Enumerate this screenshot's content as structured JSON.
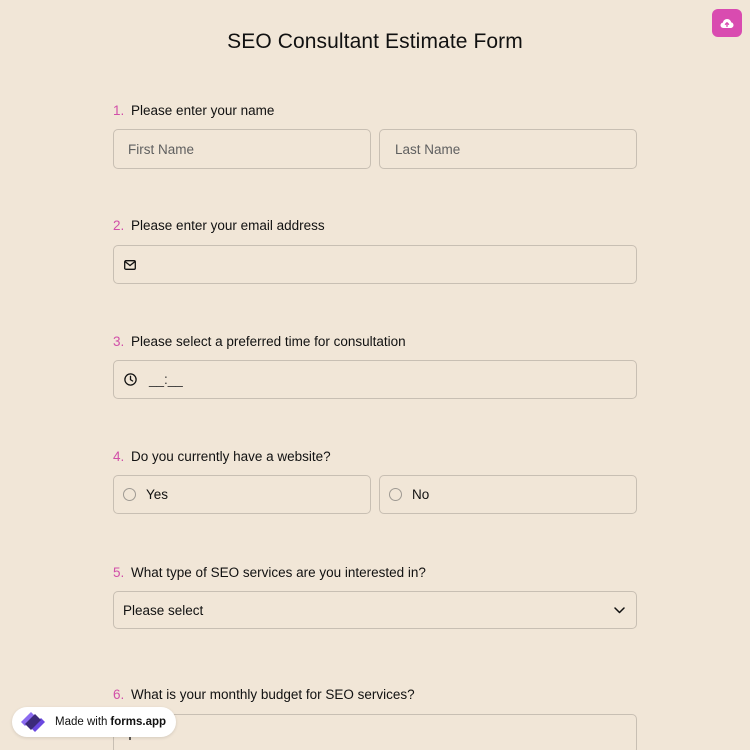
{
  "header": {
    "title": "SEO Consultant Estimate Form",
    "upload_icon": "cloud-upload-icon"
  },
  "questions": [
    {
      "number": "1.",
      "label": "Please enter your name",
      "fields": [
        {
          "placeholder": "First Name"
        },
        {
          "placeholder": "Last Name"
        }
      ]
    },
    {
      "number": "2.",
      "label": "Please enter your email address",
      "icon": "mail-icon",
      "value": ""
    },
    {
      "number": "3.",
      "label": "Please select a preferred time for consultation",
      "icon": "clock-icon",
      "mask": "__:__"
    },
    {
      "number": "4.",
      "label": "Do you currently have a website?",
      "options": [
        "Yes",
        "No"
      ]
    },
    {
      "number": "5.",
      "label": "What type of SEO services are you interested in?",
      "selected": "Please select",
      "icon": "chevron-down-icon"
    },
    {
      "number": "6.",
      "label": "What is your monthly budget for SEO services?",
      "icon": "currency-icon"
    }
  ],
  "badge": {
    "prefix": "Made with",
    "brand": "forms.app",
    "logo": "forms-app-logo-icon"
  },
  "colors": {
    "background": "#f1e6d7",
    "accent": "#d94bb0",
    "number": "#d14fa8",
    "border": "#c8bfb3"
  }
}
